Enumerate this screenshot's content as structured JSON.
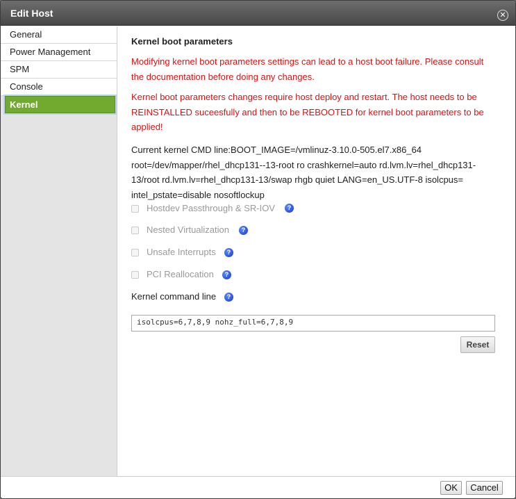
{
  "dialog": {
    "title": "Edit Host",
    "close_glyph": "✕"
  },
  "sidebar": {
    "items": [
      {
        "label": "General"
      },
      {
        "label": "Power Management"
      },
      {
        "label": "SPM"
      },
      {
        "label": "Console"
      },
      {
        "label": "Kernel",
        "active": true
      }
    ]
  },
  "kernel": {
    "heading": "Kernel boot parameters",
    "warning1": "Modifying kernel boot parameters settings can lead to a host boot failure. Please consult the documentation before doing any changes.",
    "warning2": "Kernel boot parameters changes require host deploy and restart. The host needs to be REINSTALLED suceesfully and then to be REBOOTED for kernel boot parameters to be applied!",
    "current_cmdline": "Current kernel CMD line:BOOT_IMAGE=/vmlinuz-3.10.0-505.el7.x86_64 root=/dev/mapper/rhel_dhcp131--13-root ro crashkernel=auto rd.lvm.lv=rhel_dhcp131-13/root rd.lvm.lv=rhel_dhcp131-13/swap rhgb quiet LANG=en_US.UTF-8 isolcpus= intel_pstate=disable nosoftlockup",
    "options": [
      {
        "label": "Hostdev Passthrough & SR-IOV",
        "checked": false
      },
      {
        "label": "Nested Virtualization",
        "checked": false
      },
      {
        "label": "Unsafe Interrupts",
        "checked": false
      },
      {
        "label": "PCI Reallocation",
        "checked": false
      }
    ],
    "command_line_label": "Kernel command line",
    "command_line_value": "isolcpus=6,7,8,9 nohz_full=6,7,8,9",
    "reset_label": "Reset",
    "help_glyph": "?"
  },
  "footer": {
    "ok_label": "OK",
    "cancel_label": "Cancel"
  },
  "colors": {
    "active_tab": "#72aa2f",
    "warning_text": "#e01010",
    "help_icon": "#1436c8"
  }
}
